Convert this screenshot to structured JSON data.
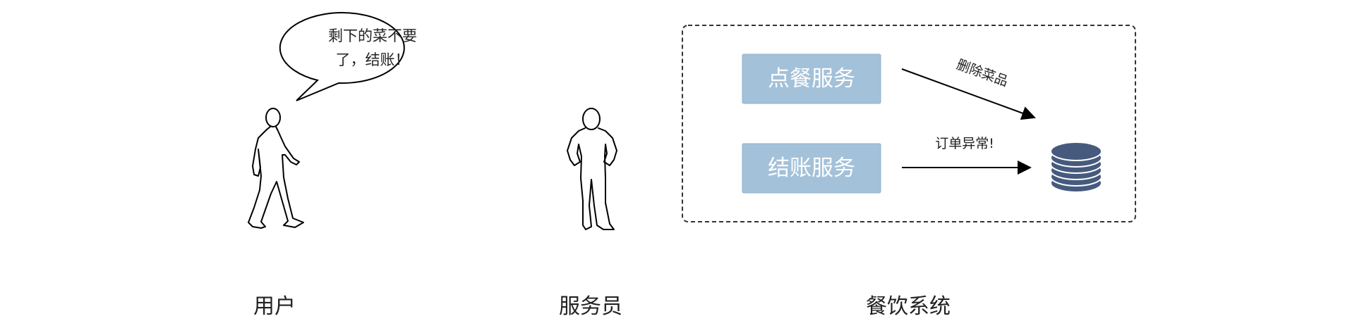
{
  "diagram": {
    "speech_bubble": {
      "line1": "剩下的菜不要",
      "line2": "了，结账！"
    },
    "actors": {
      "user": "用户",
      "waiter": "服务员",
      "system": "餐饮系统"
    },
    "services": {
      "order": "点餐服务",
      "checkout": "结账服务"
    },
    "arrows": {
      "delete_label": "删除菜品",
      "exception_label": "订单异常!"
    },
    "colors": {
      "service_box": "#a3c1d9",
      "database": "#465a7e",
      "border": "#333333"
    },
    "icons": {
      "database": "database-icon",
      "user": "walking-person-icon",
      "waiter": "standing-person-icon"
    }
  }
}
